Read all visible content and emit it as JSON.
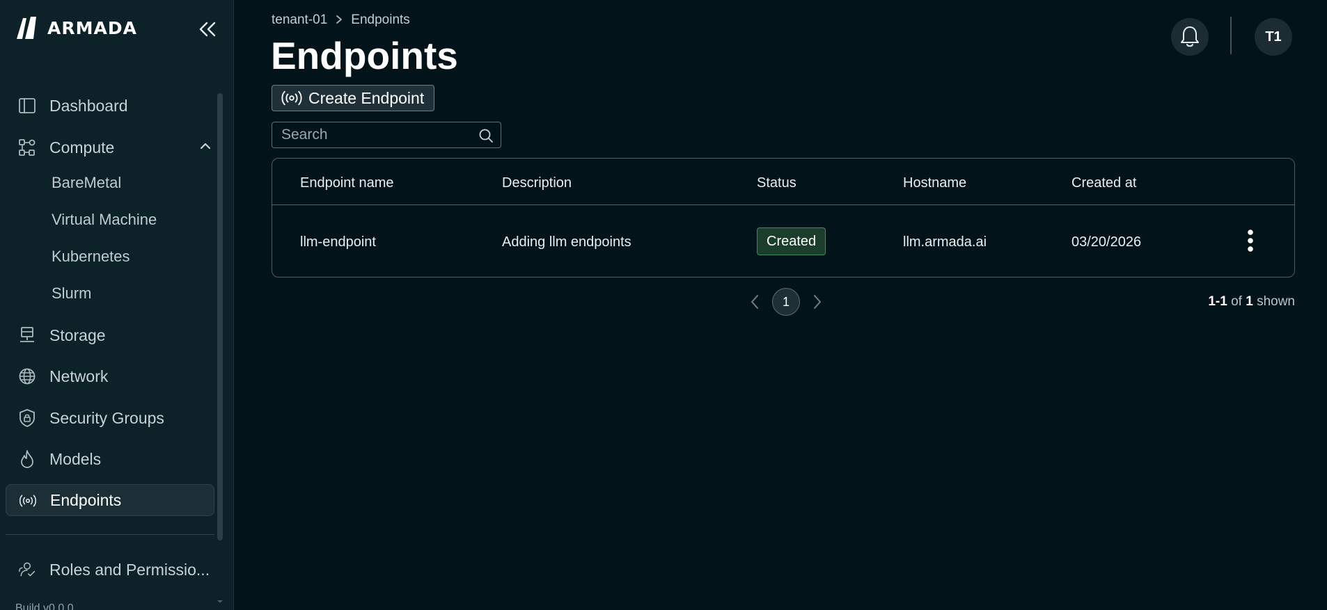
{
  "brand": {
    "name": "ARMADA"
  },
  "sidebar": {
    "items": [
      {
        "label": "Dashboard",
        "icon": "sidebar-panel-icon"
      },
      {
        "label": "Compute",
        "icon": "compute-nodes-icon",
        "expanded": true,
        "children": [
          "BareMetal",
          "Virtual Machine",
          "Kubernetes",
          "Slurm"
        ]
      },
      {
        "label": "Storage",
        "icon": "storage-icon"
      },
      {
        "label": "Network",
        "icon": "globe-icon"
      },
      {
        "label": "Security Groups",
        "icon": "shield-lock-icon"
      },
      {
        "label": "Models",
        "icon": "flame-icon"
      },
      {
        "label": "Endpoints",
        "icon": "broadcast-icon",
        "active": true
      }
    ],
    "bottom_items": [
      {
        "label": "Roles and Permissio...",
        "icon": "users-check-icon"
      }
    ],
    "footer_text": "Build v0.0.0"
  },
  "breadcrumb": {
    "items": [
      "tenant-01",
      "Endpoints"
    ]
  },
  "page": {
    "title": "Endpoints"
  },
  "header": {
    "avatar_initials": "T1"
  },
  "toolbar": {
    "create_label": "Create Endpoint",
    "search_placeholder": "Search"
  },
  "table": {
    "columns": [
      "Endpoint name",
      "Description",
      "Status",
      "Hostname",
      "Created at"
    ],
    "rows": [
      {
        "name": "llm-endpoint",
        "description": "Adding llm endpoints",
        "status": "Created",
        "hostname": "llm.armada.ai",
        "created_at": "03/20/2026"
      }
    ]
  },
  "pagination": {
    "current_page": "1",
    "range": "1-1",
    "of_word": "of",
    "total": "1",
    "shown_word": "shown"
  },
  "colors": {
    "background": "#02141a",
    "sidebar": "#0d2129",
    "status_created_bg": "#1b3d2c",
    "status_created_border": "#3e8a5e"
  }
}
